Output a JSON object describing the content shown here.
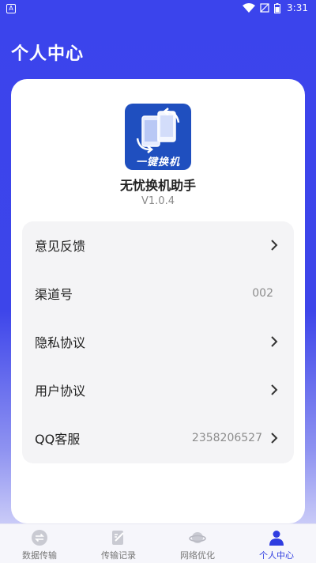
{
  "status_bar": {
    "time": "3:31",
    "left_icon": "A"
  },
  "header": {
    "title": "个人中心"
  },
  "app": {
    "logo_text": "一键换机",
    "name": "无忧换机助手",
    "version": "V1.0.4"
  },
  "menu": [
    {
      "label": "意见反馈",
      "value": "",
      "chevron": true
    },
    {
      "label": "渠道号",
      "value": "002",
      "chevron": false
    },
    {
      "label": "隐私协议",
      "value": "",
      "chevron": true
    },
    {
      "label": "用户协议",
      "value": "",
      "chevron": true
    },
    {
      "label": "QQ客服",
      "value": "2358206527",
      "chevron": true
    }
  ],
  "tabs": [
    {
      "label": "数据传输",
      "icon": "transfer-icon",
      "active": false
    },
    {
      "label": "传输记录",
      "icon": "record-icon",
      "active": false
    },
    {
      "label": "网络优化",
      "icon": "planet-icon",
      "active": false
    },
    {
      "label": "个人中心",
      "icon": "person-icon",
      "active": true
    }
  ],
  "colors": {
    "accent": "#2f3de0",
    "header_bg": "#3b44ec",
    "logo_bg": "#1f4fbf"
  }
}
